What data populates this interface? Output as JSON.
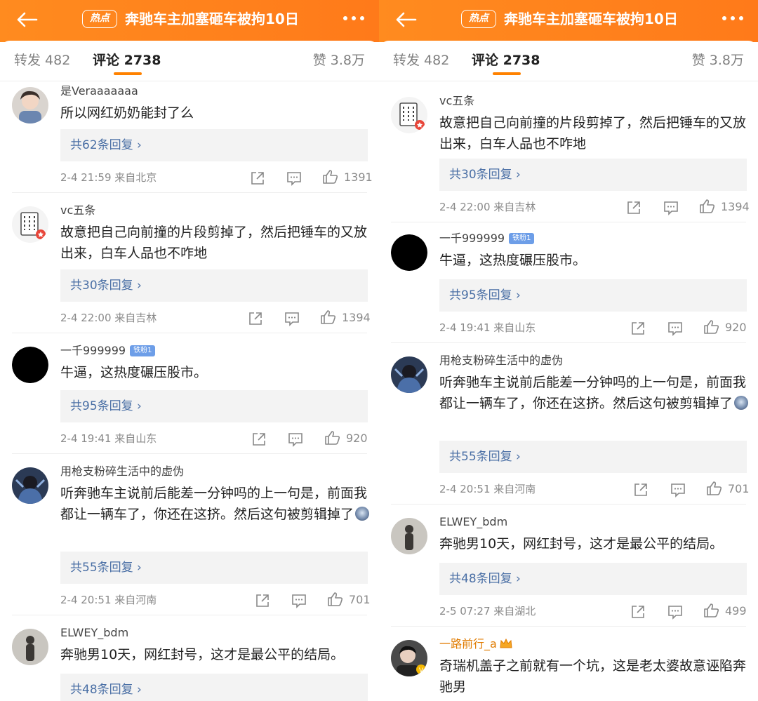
{
  "header": {
    "hot_badge": "热点",
    "title": "奔驰车主加塞砸车被拘10日"
  },
  "tabs": {
    "repost": "转发 482",
    "comments": "评论 2738",
    "likes": "赞 3.8万"
  },
  "colors": {
    "header_orange": "#ff8200",
    "link_blue": "#4a6fa5",
    "tab_underline": "#ff8200"
  },
  "icons": [
    "back-arrow-icon",
    "more-dots-icon",
    "share-icon",
    "comment-icon",
    "like-thumb-icon",
    "crown-icon"
  ],
  "left": {
    "comments": [
      {
        "user": "是Veraaaaaaa",
        "text": "所以网红奶奶能封了么",
        "replies": "共62条回复 ›",
        "meta": "2-4 21:59  来自北京",
        "likes": "1391"
      },
      {
        "user": "vc五条",
        "text": "故意把自己向前撞的片段剪掉了，然后把锤车的又放出来，白车人品也不咋地",
        "replies": "共30条回复 ›",
        "meta": "2-4 22:00  来自吉林",
        "likes": "1394"
      },
      {
        "user": "一千999999",
        "fan_badge": "铁粉1",
        "text": "牛逼，这热度碾压股市。",
        "replies": "共95条回复 ›",
        "meta": "2-4 19:41  来自山东",
        "likes": "920"
      },
      {
        "user": "用枪支粉碎生活中的虚伪",
        "text": "听奔驰车主说前后能差一分钟吗的上一句是，前面我都让一辆车了，你还在这挤。然后这句被剪辑掉了",
        "replies": "共55条回复 ›",
        "meta": "2-4 20:51  来自河南",
        "likes": "701"
      },
      {
        "user": "ELWEY_bdm",
        "text": "奔驰男10天，网红封号，这才是最公平的结局。",
        "replies": "共48条回复 ›"
      }
    ]
  },
  "right": {
    "comments": [
      {
        "user": "vc五条",
        "text": "故意把自己向前撞的片段剪掉了，然后把锤车的又放出来，白车人品也不咋地",
        "replies": "共30条回复 ›",
        "meta": "2-4 22:00  来自吉林",
        "likes": "1394"
      },
      {
        "user": "一千999999",
        "fan_badge": "铁粉1",
        "text": "牛逼，这热度碾压股市。",
        "replies": "共95条回复 ›",
        "meta": "2-4 19:41  来自山东",
        "likes": "920"
      },
      {
        "user": "用枪支粉碎生活中的虚伪",
        "text": "听奔驰车主说前后能差一分钟吗的上一句是，前面我都让一辆车了，你还在这挤。然后这句被剪辑掉了",
        "replies": "共55条回复 ›",
        "meta": "2-4 20:51  来自河南",
        "likes": "701"
      },
      {
        "user": "ELWEY_bdm",
        "text": "奔驰男10天，网红封号，这才是最公平的结局。",
        "replies": "共48条回复 ›",
        "meta": "2-5 07:27  来自湖北",
        "likes": "499"
      },
      {
        "user": "一路前行_a",
        "text": "奇瑞机盖子之前就有一个坑，这是老太婆故意诬陷奔驰男"
      }
    ]
  }
}
